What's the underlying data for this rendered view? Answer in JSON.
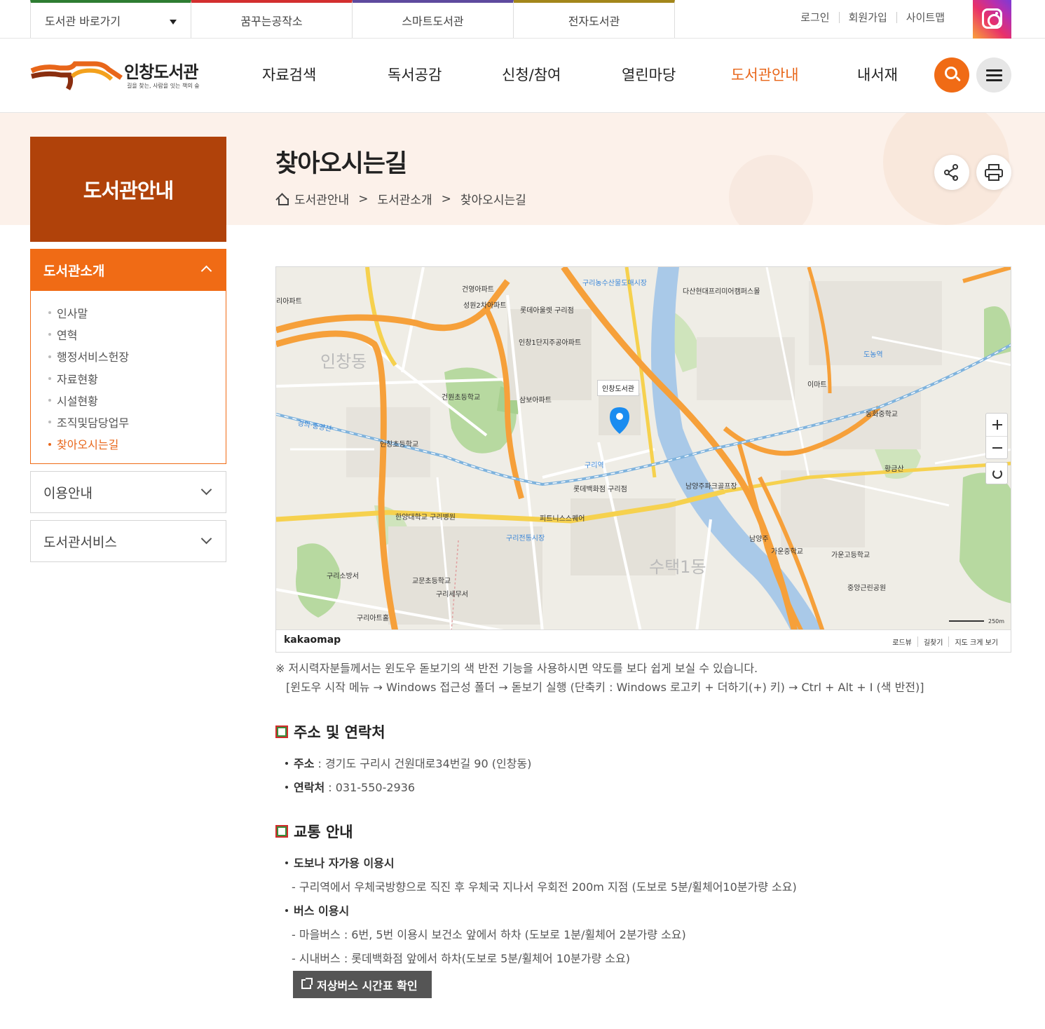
{
  "topbar": {
    "quick_select": "도서관 바로가기",
    "links": [
      "꿈꾸는공작소",
      "스마트도서관",
      "전자도서관"
    ],
    "link_colors": [
      "#2e7d32",
      "#d32f2f",
      "#5e4a9e",
      "#a3861a"
    ],
    "user_links": [
      "로그인",
      "회원가입",
      "사이트맵"
    ]
  },
  "logo": {
    "title": "인창도서관",
    "subtitle": "길을 찾는, 사람을 잇는 책의 숲"
  },
  "gnb": [
    "자료검색",
    "독서공감",
    "신청/참여",
    "열린마당",
    "도서관안내",
    "내서재"
  ],
  "gnb_active": "도서관안내",
  "sidebar": {
    "title": "도서관안내",
    "open_menu": {
      "label": "도서관소개",
      "items": [
        "인사말",
        "연혁",
        "행정서비스헌장",
        "자료현황",
        "시설현황",
        "조직및담당업무",
        "찾아오시는길"
      ],
      "active": "찾아오시는길"
    },
    "closed_menus": [
      "이용안내",
      "도서관서비스"
    ]
  },
  "page": {
    "title": "찾아오시는길",
    "breadcrumb": [
      "도서관안내",
      "도서관소개",
      "찾아오시는길"
    ],
    "breadcrumb_sep": ">"
  },
  "map": {
    "brand": "kakaomap",
    "footer_links": [
      "로드뷰",
      "길찾기",
      "지도 크게 보기"
    ],
    "pin_label": "인창도서관",
    "scale": "250m",
    "labels": [
      "인창동",
      "수택1동",
      "구리역",
      "롯데백화점 구리점",
      "구리전통시장",
      "한양대학교 구리병원",
      "인창초등학교",
      "건원초등학교",
      "교문초등학교",
      "구리세무서",
      "구리아트홀",
      "구리소방서",
      "황금산",
      "남양주",
      "도농역",
      "가운고등학교",
      "가운중학교",
      "동화중학교",
      "이마트",
      "피트니스스퀘어",
      "경의·중앙선",
      "구리농수산물도매시장",
      "삼보아파트",
      "인창1단지주공아파트",
      "롯데아울렛 구리점",
      "성원2차아파트",
      "건영아파트",
      "다산현대프리미어캠퍼스몰",
      "남양주파크골프장",
      "중앙근린공원",
      "리아파트"
    ]
  },
  "notice": {
    "line1": "※ 저시력자분들께서는 윈도우 돋보기의 색 반전 기능을 사용하시면 약도를 보다 쉽게 보실 수 있습니다.",
    "line2": "[윈도우 시작 메뉴 → Windows 접근성 폴더 → 돋보기 실행 (단축키 : Windows 로고키 + 더하기(+) 키) → Ctrl + Alt + I (색 반전)]"
  },
  "contact": {
    "title": "주소 및 연락처",
    "address_label": "주소",
    "address": " : 경기도 구리시 건원대로34번길 90 (인창동)",
    "phone_label": "연락처",
    "phone": " : 031-550-2936"
  },
  "traffic": {
    "title": "교통 안내",
    "walk_title": "도보나 자가용 이용시",
    "walk_desc": "- 구리역에서 우체국방향으로 직진 후 우체국 지나서 우회전 200m 지점 (도보로 5분/휠체어10분가량 소요)",
    "bus_title": "버스 이용시",
    "bus_village": "- 마을버스 : 6번, 5번 이용시 보건소 앞에서 하차 (도보로 1분/휠체어 2분가량 소요)",
    "bus_city": "- 시내버스 : 롯데백화점 앞에서 하차(도보로 5분/휠체어 10분가량 소요)",
    "button": "저상버스 시간표 확인"
  },
  "colors": {
    "accent": "#f06b15",
    "side_title_bg": "#b0420a",
    "visual_bg": "#fcf1ea"
  }
}
